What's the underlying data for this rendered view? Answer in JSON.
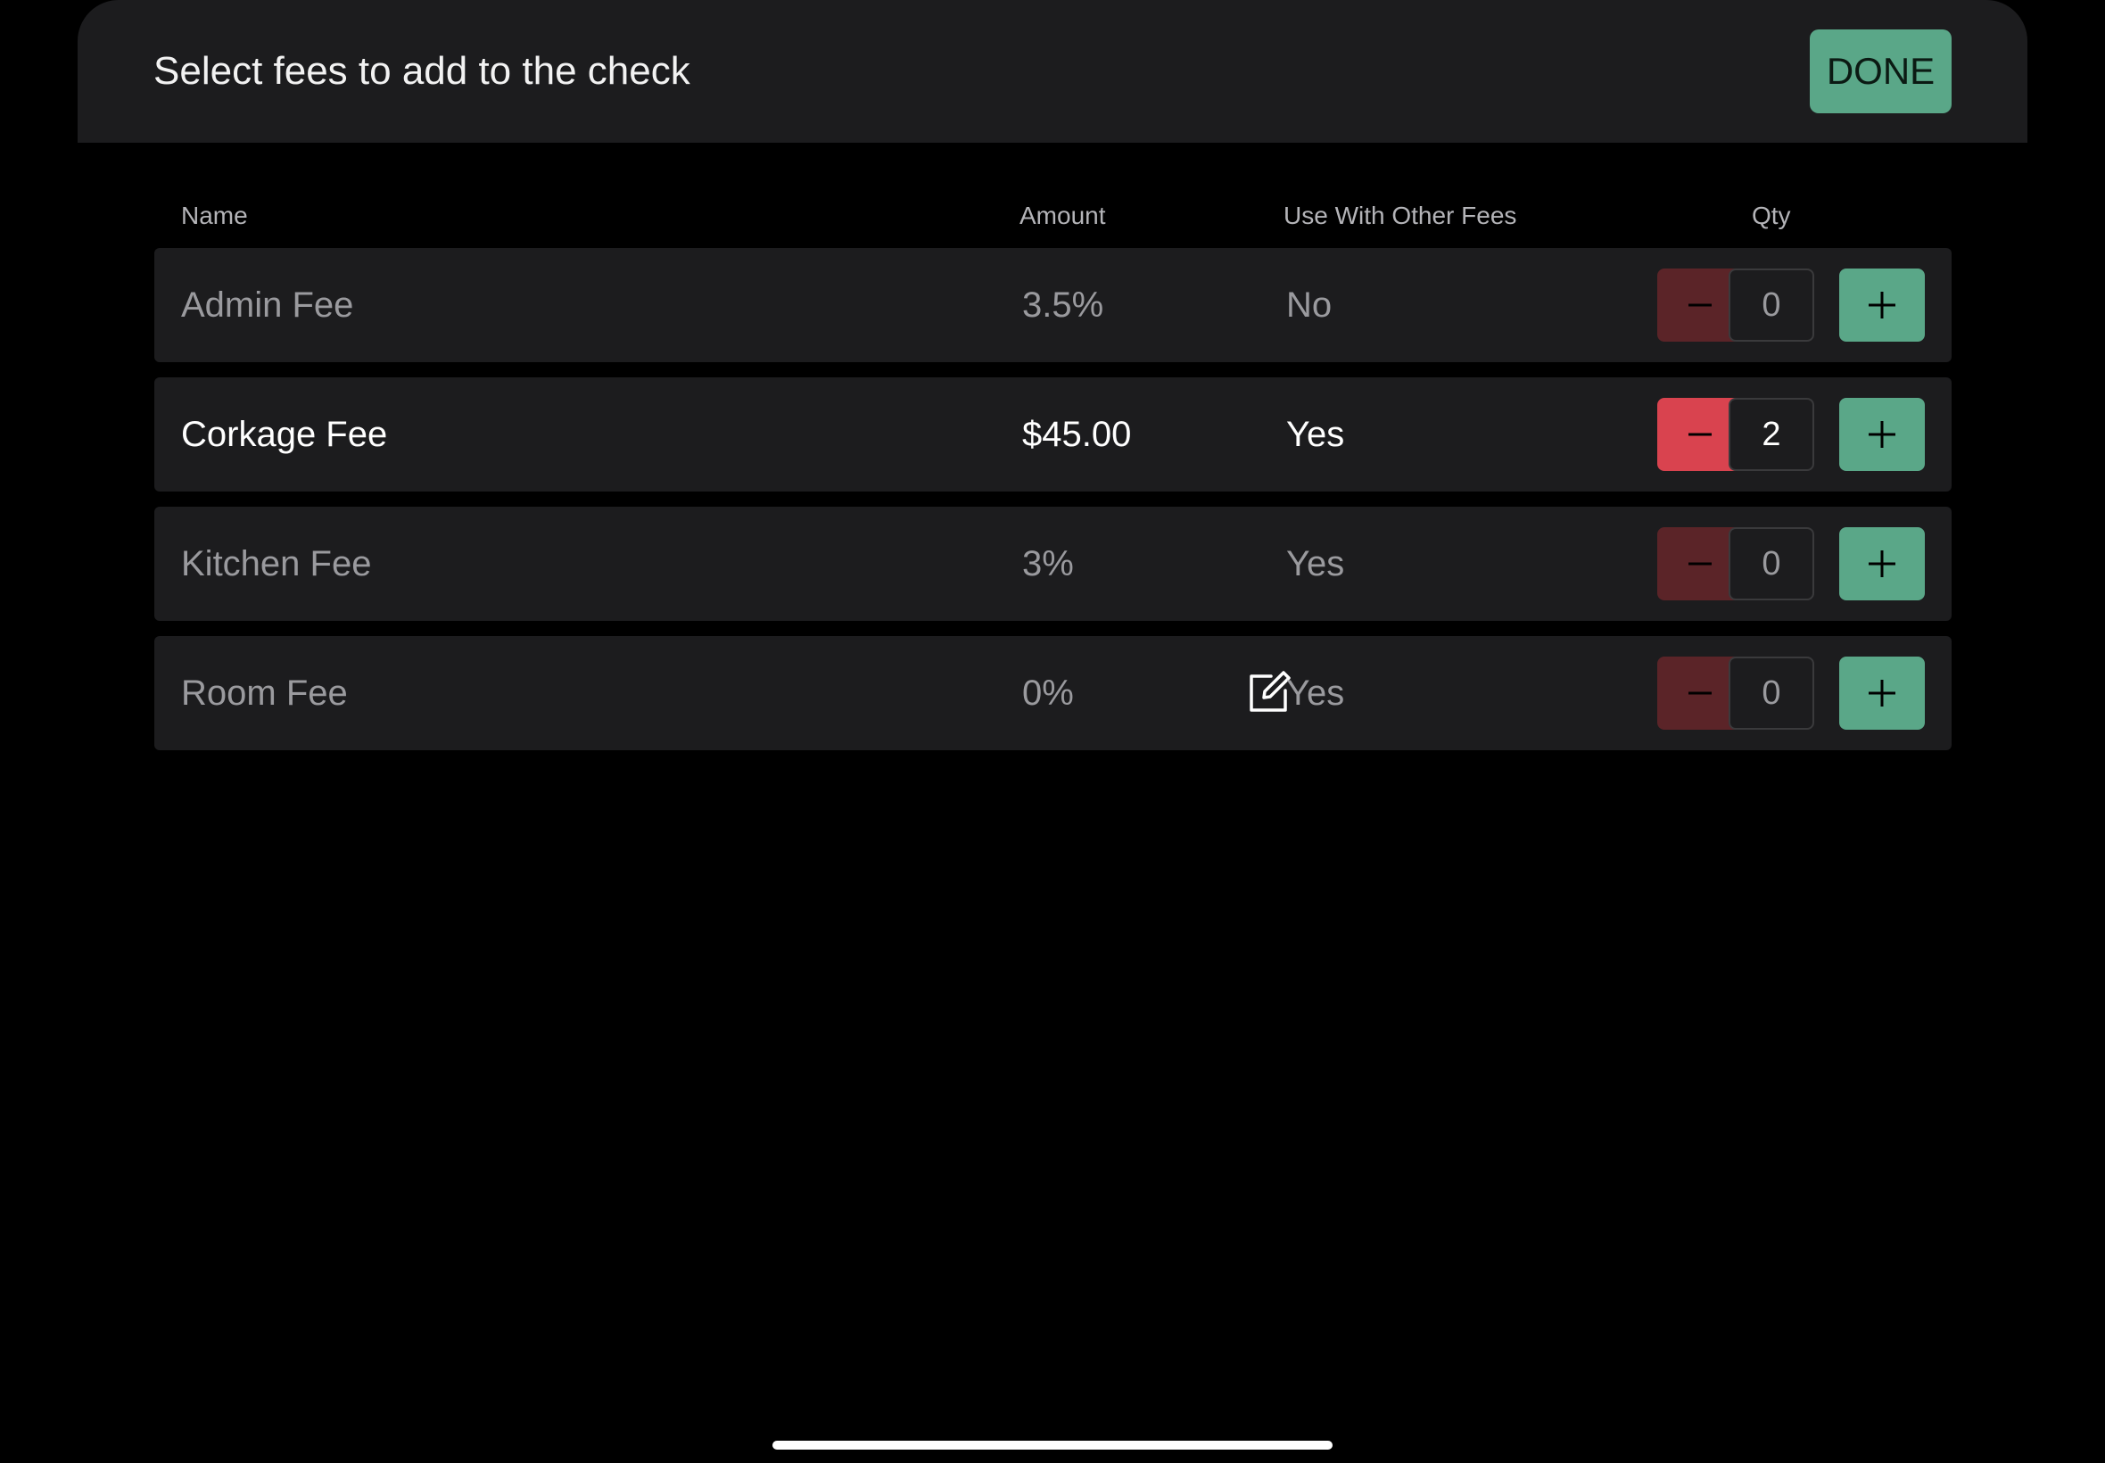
{
  "header": {
    "title": "Select fees to add to the check",
    "done_label": "DONE"
  },
  "columns": {
    "name": "Name",
    "amount": "Amount",
    "combine": "Use With Other Fees",
    "qty": "Qty"
  },
  "fees": [
    {
      "name": "Admin Fee",
      "amount": "3.5%",
      "combine": "No",
      "qty": "0",
      "editable": false,
      "selected": false
    },
    {
      "name": "Corkage Fee",
      "amount": "$45.00",
      "combine": "Yes",
      "qty": "2",
      "editable": false,
      "selected": true
    },
    {
      "name": "Kitchen Fee",
      "amount": "3%",
      "combine": "Yes",
      "qty": "0",
      "editable": false,
      "selected": false
    },
    {
      "name": "Room Fee",
      "amount": "0%",
      "combine": "Yes",
      "qty": "0",
      "editable": true,
      "selected": false
    }
  ],
  "icons": {
    "edit": "edit-icon",
    "minus": "minus-icon",
    "plus": "plus-icon"
  },
  "colors": {
    "accent_green": "#5aa788",
    "decrement_active": "#d9434f",
    "decrement_inactive": "#5b2428",
    "panel": "#1c1c1e",
    "background": "#000000"
  }
}
